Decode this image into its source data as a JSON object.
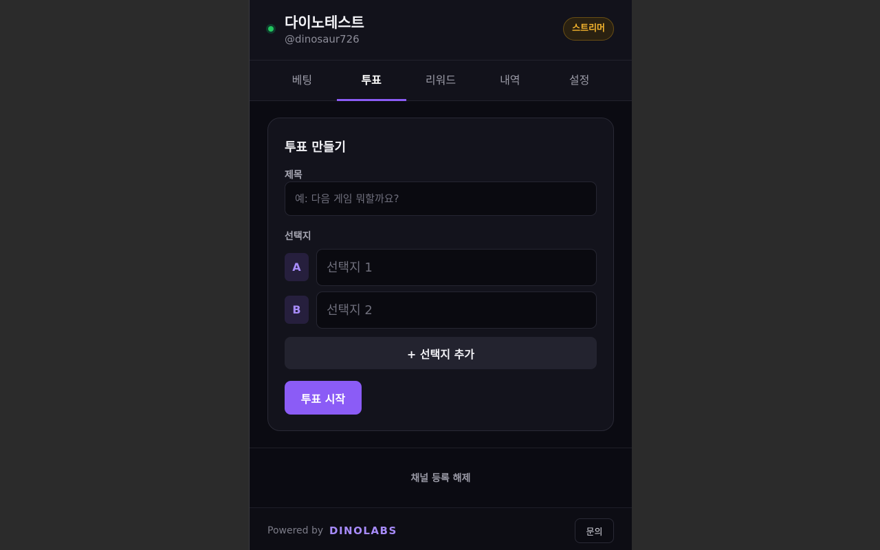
{
  "header": {
    "channel_name": "다이노테스트",
    "channel_handle": "@dinosaur726",
    "role_badge": "스트리머",
    "status": "online"
  },
  "tabs": [
    {
      "label": "베팅",
      "active": false
    },
    {
      "label": "투표",
      "active": true
    },
    {
      "label": "리워드",
      "active": false
    },
    {
      "label": "내역",
      "active": false
    },
    {
      "label": "설정",
      "active": false
    }
  ],
  "poll_form": {
    "title": "투표 만들기",
    "title_field_label": "제목",
    "title_placeholder": "예: 다음 게임 뭐할까요?",
    "options_label": "선택지",
    "options": [
      {
        "letter": "A",
        "placeholder": "선택지 1"
      },
      {
        "letter": "B",
        "placeholder": "선택지 2"
      }
    ],
    "add_option_label": "+ 선택지 추가",
    "start_button_label": "투표 시작"
  },
  "unregister_label": "채널 등록 해제",
  "footer": {
    "powered_by": "Powered by",
    "brand": "DINOLABS",
    "inquiry_label": "문의"
  },
  "colors": {
    "accent": "#8b5cf6",
    "badge": "#f5b52e",
    "online": "#22c55e"
  },
  "icons": [
    "online-status-icon",
    "drag-handle-icon"
  ]
}
